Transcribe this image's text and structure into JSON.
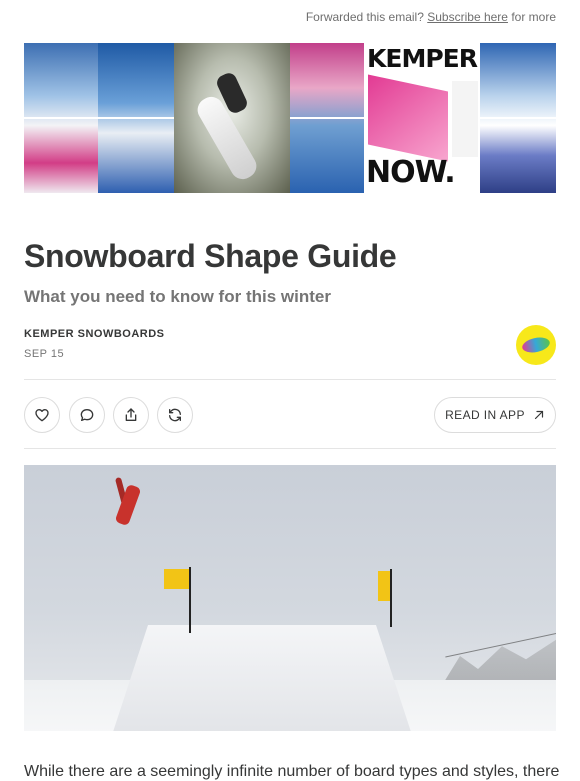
{
  "header": {
    "forward_prefix": "Forwarded this email?",
    "subscribe_link": "Subscribe here",
    "forward_suffix": "for more"
  },
  "banner": {
    "kemper_text": "KEMPER",
    "now_text": "NOW."
  },
  "post": {
    "title": "Snowboard Shape Guide",
    "subtitle": "What you need to know for this winter",
    "author": "KEMPER SNOWBOARDS",
    "date": "SEP 15"
  },
  "actions": {
    "like_icon": "heart-icon",
    "comment_icon": "comment-icon",
    "share_icon": "share-icon",
    "restack_icon": "restack-icon",
    "read_in_app_label": "READ IN APP"
  },
  "body": {
    "first_line": "While there are a seemingly infinite number of board types and styles, there"
  },
  "colors": {
    "text": "#363737",
    "muted": "#757575",
    "border": "#dcdcdc",
    "avatar_bg": "#f7e81a"
  }
}
